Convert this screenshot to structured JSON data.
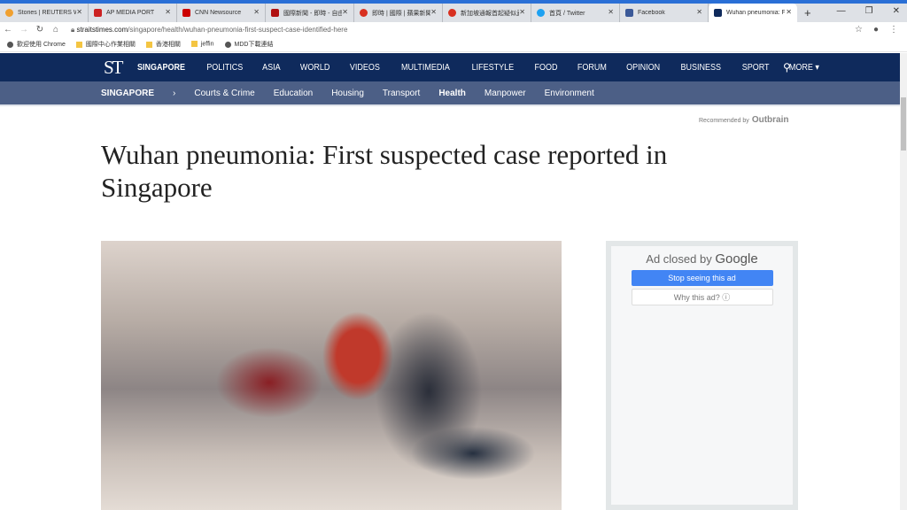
{
  "browser": {
    "tabs": [
      {
        "title": "Stories | REUTERS WO",
        "color": "#f0a030"
      },
      {
        "title": "AP MEDIA PORT",
        "color": "#cc2222"
      },
      {
        "title": "CNN Newsource",
        "color": "#cc0000"
      },
      {
        "title": "國際新聞 - 即時 - 自由",
        "color": "#b01010"
      },
      {
        "title": "即時 | 國際 | 蘋果新聞",
        "color": "#d83020"
      },
      {
        "title": "新加坡通報首起疑似武漢",
        "color": "#d83020"
      },
      {
        "title": "首頁 / Twitter",
        "color": "#1da1f2"
      },
      {
        "title": "Facebook",
        "color": "#3b5998"
      },
      {
        "title": "Wuhan pneumonia: F",
        "color": "#0f2a5c"
      }
    ],
    "new_tab": "+",
    "url_host": "straitstimes.com",
    "url_path": "/singapore/health/wuhan-pneumonia-first-suspect-case-identified-here",
    "bookmarks": [
      {
        "label": "歡迎使用 Chrome",
        "icon": "globe"
      },
      {
        "label": "國際中心作業相關",
        "icon": "folder"
      },
      {
        "label": "香港相關",
        "icon": "folder"
      },
      {
        "label": "jeffin",
        "icon": "folder"
      },
      {
        "label": "MDD下載連結",
        "icon": "globe"
      }
    ]
  },
  "site": {
    "logo": "ST",
    "main_nav": [
      "SINGAPORE",
      "POLITICS",
      "ASIA",
      "WORLD",
      "VIDEOS",
      "MULTIMEDIA",
      "LIFESTYLE",
      "FOOD",
      "FORUM",
      "OPINION",
      "BUSINESS",
      "SPORT",
      "MORE ▾"
    ],
    "sub_nav": [
      "SINGAPORE",
      "›",
      "Courts & Crime",
      "Education",
      "Housing",
      "Transport",
      "Health",
      "Manpower",
      "Environment"
    ],
    "recommended": "Recommended by",
    "outbrain": "Outbrain",
    "headline": "Wuhan pneumonia: First suspected case reported in Singapore",
    "ad": {
      "closed_prefix": "Ad closed by ",
      "closed_brand": "Google",
      "stop": "Stop seeing this ad",
      "why": "Why this ad? ⓘ"
    }
  }
}
